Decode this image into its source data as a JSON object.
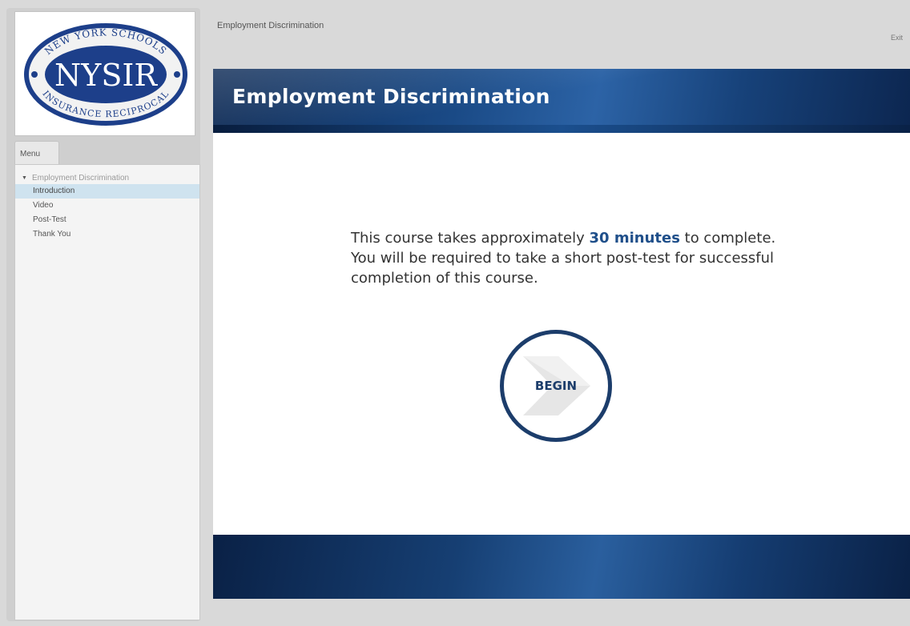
{
  "logo": {
    "top_text": "NEW YORK SCHOOLS",
    "main_text": "NYSIR",
    "bottom_text": "INSURANCE RECIPROCAL",
    "colors": {
      "navy": "#1d3f8a",
      "ring": "#f2f2f2"
    }
  },
  "menu": {
    "tab_label": "Menu",
    "group_label": "Employment Discrimination",
    "items": [
      {
        "label": "Introduction",
        "active": true
      },
      {
        "label": "Video",
        "active": false
      },
      {
        "label": "Post-Test",
        "active": false
      },
      {
        "label": "Thank You",
        "active": false
      }
    ]
  },
  "header": {
    "title": "Employment Discrimination",
    "exit_label": "Exit"
  },
  "banner": {
    "title": "Employment Discrimination"
  },
  "intro": {
    "text_before": "This course takes approximately ",
    "highlight": "30 minutes",
    "text_after": " to complete. You will be required to take a short post-test for successful completion of this course."
  },
  "begin_button": {
    "label": "BEGIN",
    "icon": "chevron-right-icon"
  },
  "colors": {
    "accent": "#1c3d6b",
    "highlight": "#1f4f8a",
    "active_menu": "#cfe3ef"
  }
}
